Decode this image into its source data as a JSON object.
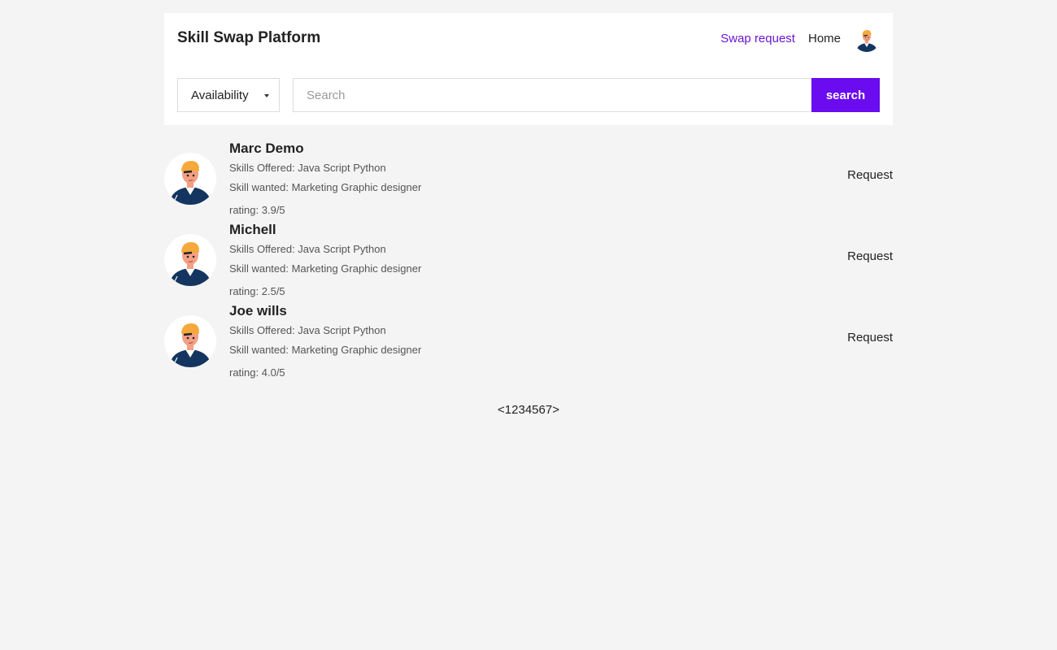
{
  "header": {
    "title": "Skill Swap Platform",
    "nav": {
      "swap_request": "Swap request",
      "home": "Home"
    }
  },
  "filters": {
    "availability_label": "Availability",
    "search_placeholder": "Search",
    "search_value": "",
    "search_button": "search"
  },
  "users": [
    {
      "name": "Marc Demo",
      "skills_offered": "Skills Offered: Java Script Python",
      "skills_wanted": "Skill wanted: Marketing Graphic designer",
      "rating": "rating: 3.9/5",
      "action": "Request"
    },
    {
      "name": "Michell",
      "skills_offered": "Skills Offered: Java Script Python",
      "skills_wanted": "Skill wanted: Marketing Graphic designer",
      "rating": "rating: 2.5/5",
      "action": "Request"
    },
    {
      "name": "Joe wills",
      "skills_offered": "Skills Offered: Java Script Python",
      "skills_wanted": "Skill wanted: Marketing Graphic designer",
      "rating": "rating: 4.0/5",
      "action": "Request"
    }
  ],
  "pagination": {
    "prev": "<",
    "pages": [
      "1",
      "2",
      "3",
      "4",
      "5",
      "6",
      "7"
    ],
    "next": ">"
  },
  "colors": {
    "accent": "#6a0bf0",
    "link": "#6a16d4",
    "background": "#f4f4f4",
    "avatar_shirt": "#13355f",
    "avatar_cap": "#f5a93b",
    "avatar_skin": "#f4a085"
  },
  "icons": {
    "avatar": "user-avatar-illustration",
    "dropdown": "caret-down-icon"
  }
}
